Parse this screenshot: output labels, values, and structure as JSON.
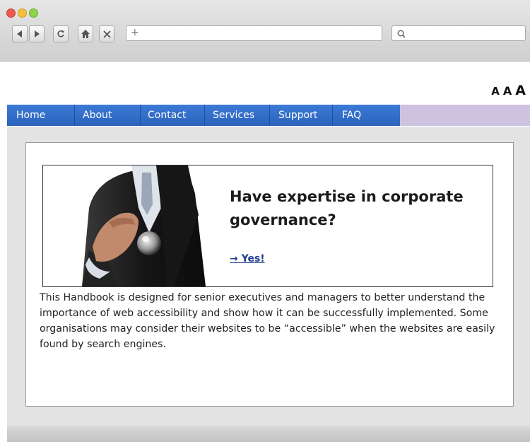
{
  "browser": {
    "new_tab_symbol": "+",
    "url_value": "",
    "search_value": ""
  },
  "text_resize": [
    "A",
    "A",
    "A"
  ],
  "nav": {
    "items": [
      {
        "label": "Home"
      },
      {
        "label": "About"
      },
      {
        "label": "Contact"
      },
      {
        "label": "Services"
      },
      {
        "label": "Support"
      },
      {
        "label": "FAQ"
      }
    ]
  },
  "banner": {
    "headline": "Have expertise in corporate governance?",
    "link_label": "→ Yes!"
  },
  "body_text": "This Handbook is designed for senior executives and managers to better understand the importance of web accessibility and show how it can be successfully implemented. Some organisations may consider their websites to be “accessible” when the websites are easily found by search engines.",
  "colors": {
    "nav_blue": "#2f6cc6",
    "nav_fill": "#cdc3e0",
    "link": "#1f3f8f"
  }
}
